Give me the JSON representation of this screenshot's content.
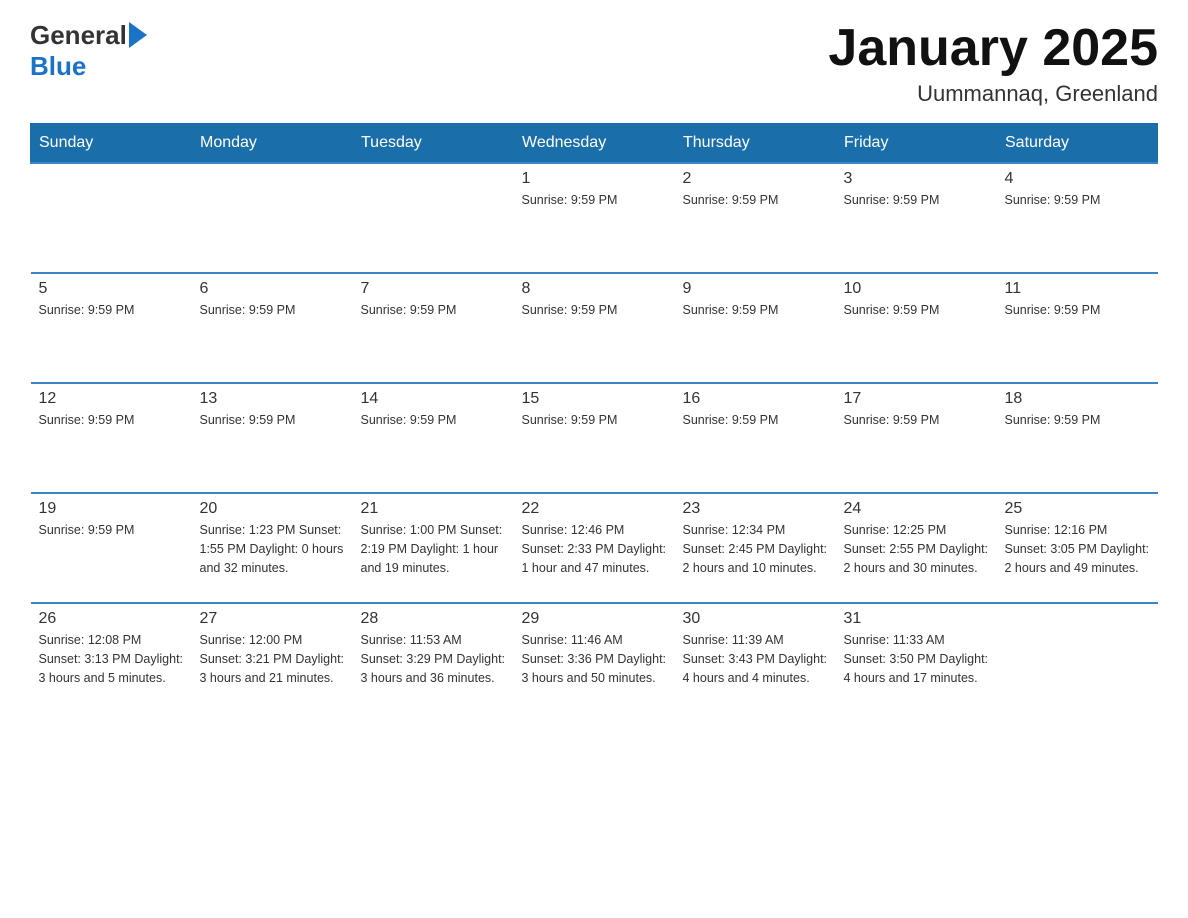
{
  "header": {
    "logo_general": "General",
    "logo_blue": "Blue",
    "month_title": "January 2025",
    "location": "Uummannaq, Greenland"
  },
  "days_of_week": [
    "Sunday",
    "Monday",
    "Tuesday",
    "Wednesday",
    "Thursday",
    "Friday",
    "Saturday"
  ],
  "weeks": [
    [
      {
        "day": "",
        "info": ""
      },
      {
        "day": "",
        "info": ""
      },
      {
        "day": "",
        "info": ""
      },
      {
        "day": "1",
        "info": "Sunrise: 9:59 PM"
      },
      {
        "day": "2",
        "info": "Sunrise: 9:59 PM"
      },
      {
        "day": "3",
        "info": "Sunrise: 9:59 PM"
      },
      {
        "day": "4",
        "info": "Sunrise: 9:59 PM"
      }
    ],
    [
      {
        "day": "5",
        "info": "Sunrise: 9:59 PM"
      },
      {
        "day": "6",
        "info": "Sunrise: 9:59 PM"
      },
      {
        "day": "7",
        "info": "Sunrise: 9:59 PM"
      },
      {
        "day": "8",
        "info": "Sunrise: 9:59 PM"
      },
      {
        "day": "9",
        "info": "Sunrise: 9:59 PM"
      },
      {
        "day": "10",
        "info": "Sunrise: 9:59 PM"
      },
      {
        "day": "11",
        "info": "Sunrise: 9:59 PM"
      }
    ],
    [
      {
        "day": "12",
        "info": "Sunrise: 9:59 PM"
      },
      {
        "day": "13",
        "info": "Sunrise: 9:59 PM"
      },
      {
        "day": "14",
        "info": "Sunrise: 9:59 PM"
      },
      {
        "day": "15",
        "info": "Sunrise: 9:59 PM"
      },
      {
        "day": "16",
        "info": "Sunrise: 9:59 PM"
      },
      {
        "day": "17",
        "info": "Sunrise: 9:59 PM"
      },
      {
        "day": "18",
        "info": "Sunrise: 9:59 PM"
      }
    ],
    [
      {
        "day": "19",
        "info": "Sunrise: 9:59 PM"
      },
      {
        "day": "20",
        "info": "Sunrise: 1:23 PM\nSunset: 1:55 PM\nDaylight: 0 hours and 32 minutes."
      },
      {
        "day": "21",
        "info": "Sunrise: 1:00 PM\nSunset: 2:19 PM\nDaylight: 1 hour and 19 minutes."
      },
      {
        "day": "22",
        "info": "Sunrise: 12:46 PM\nSunset: 2:33 PM\nDaylight: 1 hour and 47 minutes."
      },
      {
        "day": "23",
        "info": "Sunrise: 12:34 PM\nSunset: 2:45 PM\nDaylight: 2 hours and 10 minutes."
      },
      {
        "day": "24",
        "info": "Sunrise: 12:25 PM\nSunset: 2:55 PM\nDaylight: 2 hours and 30 minutes."
      },
      {
        "day": "25",
        "info": "Sunrise: 12:16 PM\nSunset: 3:05 PM\nDaylight: 2 hours and 49 minutes."
      }
    ],
    [
      {
        "day": "26",
        "info": "Sunrise: 12:08 PM\nSunset: 3:13 PM\nDaylight: 3 hours and 5 minutes."
      },
      {
        "day": "27",
        "info": "Sunrise: 12:00 PM\nSunset: 3:21 PM\nDaylight: 3 hours and 21 minutes."
      },
      {
        "day": "28",
        "info": "Sunrise: 11:53 AM\nSunset: 3:29 PM\nDaylight: 3 hours and 36 minutes."
      },
      {
        "day": "29",
        "info": "Sunrise: 11:46 AM\nSunset: 3:36 PM\nDaylight: 3 hours and 50 minutes."
      },
      {
        "day": "30",
        "info": "Sunrise: 11:39 AM\nSunset: 3:43 PM\nDaylight: 4 hours and 4 minutes."
      },
      {
        "day": "31",
        "info": "Sunrise: 11:33 AM\nSunset: 3:50 PM\nDaylight: 4 hours and 17 minutes."
      },
      {
        "day": "",
        "info": ""
      }
    ]
  ]
}
